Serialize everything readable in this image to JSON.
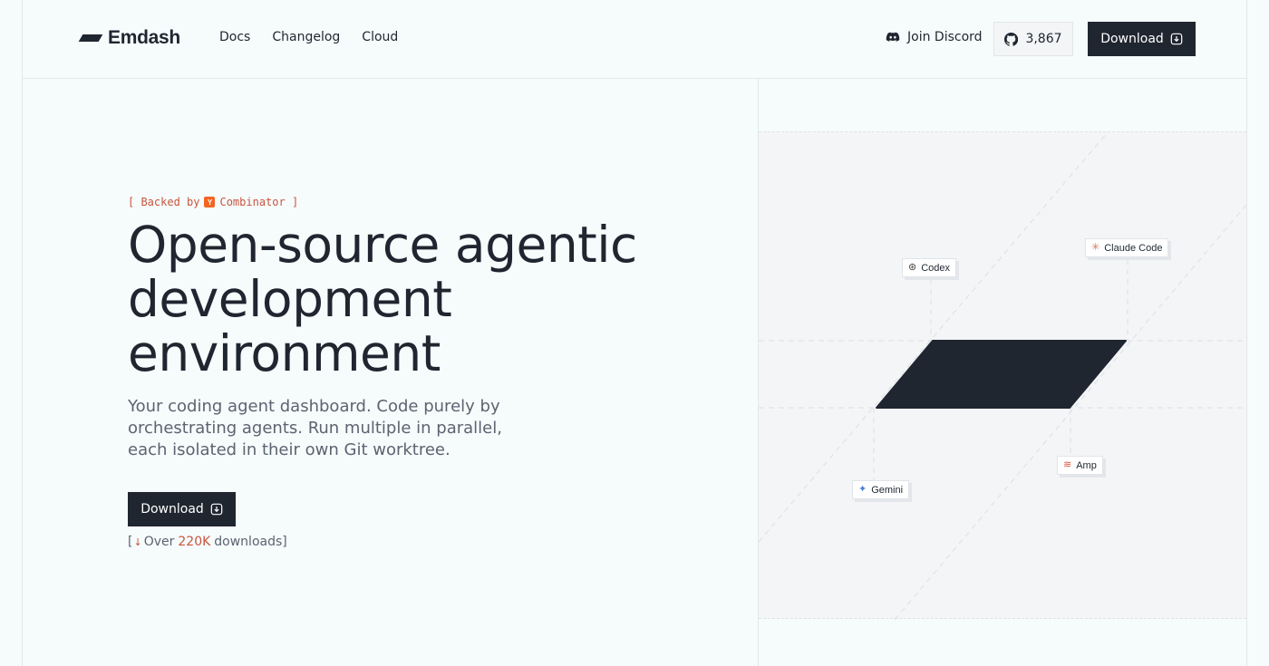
{
  "header": {
    "logo_text": "Emdash",
    "nav": [
      "Docs",
      "Changelog",
      "Cloud"
    ],
    "discord_label": "Join Discord",
    "github_stars": "3,867",
    "download_label": "Download"
  },
  "hero": {
    "backed_open": "[ Backed by",
    "backed_badge": "Y",
    "backed_close": "Combinator ]",
    "title": "Open-source agentic development environment",
    "subtitle": "Your coding agent dashboard. Code purely by orchestrating agents. Run multiple in parallel, each isolated in their own Git worktree.",
    "download_label": "Download",
    "stat_open": "[",
    "stat_prefix": "Over",
    "stat_number": "220K",
    "stat_suffix": "downloads]"
  },
  "agents": {
    "codex": "Codex",
    "claude": "Claude Code",
    "amp": "Amp",
    "gemini": "Gemini"
  },
  "colors": {
    "dark": "#1f2630",
    "accent": "#c8553d",
    "yc": "#f26522",
    "background": "#f6fbfc"
  },
  "icons": {
    "codex": "openai-icon",
    "claude": "claude-spark-icon",
    "amp": "amp-icon",
    "gemini": "gemini-sparkle-icon"
  }
}
